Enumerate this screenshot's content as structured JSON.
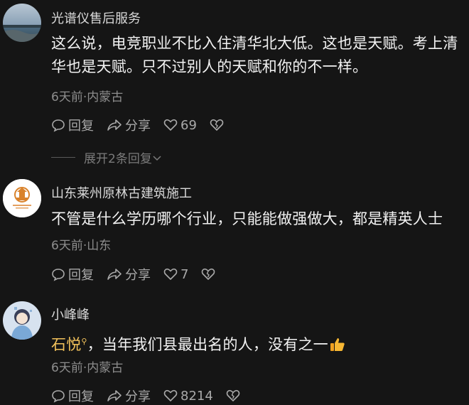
{
  "comments": [
    {
      "username": "光谱仪售后服务",
      "text": "这么说，电竞职业不比入住清华北大低。这也是天赋。考上清华也是天赋。只不过别人的天赋和你的不一样。",
      "meta": "6天前·内蒙古",
      "reply_label": "回复",
      "share_label": "分享",
      "like_count": "69",
      "expand_label": "展开2条回复"
    },
    {
      "username": "山东莱州原林古建筑施工",
      "text": "不管是什么学历哪个行业，只能能做强做大，都是精英人士",
      "meta": "6天前·山东",
      "reply_label": "回复",
      "share_label": "分享",
      "like_count": "7"
    },
    {
      "username": "小峰峰",
      "mention": "石悦",
      "text": "，当年我们县最出名的人，没有之一",
      "meta": "6天前·内蒙古",
      "reply_label": "回复",
      "share_label": "分享",
      "like_count": "8214"
    }
  ],
  "icons": {
    "reply": "reply-icon",
    "share": "share-icon",
    "like": "heart-icon",
    "dislike": "broken-heart-icon",
    "expand": "chevron-down-icon",
    "emoji": "thumbs-up-icon"
  },
  "colors": {
    "background": "#151515",
    "mention": "#f2c25b",
    "meta": "#8d8d8d"
  }
}
